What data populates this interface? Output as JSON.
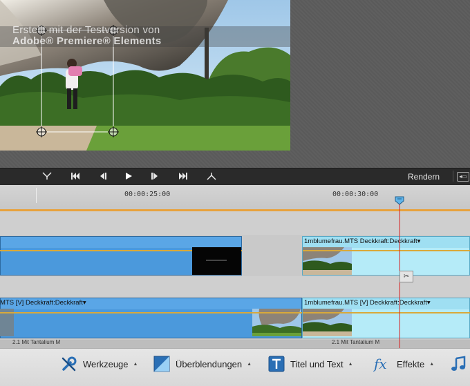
{
  "monitor": {
    "watermark_line1": "Erstellt mit der Testversion von",
    "watermark_line2": "Adobe® Premiere® Elements"
  },
  "transport": {
    "buttons": [
      {
        "name": "goto-in-button",
        "glyph": "⊻"
      },
      {
        "name": "goto-start-button",
        "glyph": "⏮"
      },
      {
        "name": "step-back-button",
        "glyph": "◀❙"
      },
      {
        "name": "play-button",
        "glyph": "▶"
      },
      {
        "name": "step-forward-button",
        "glyph": "❙▶"
      },
      {
        "name": "goto-end-button",
        "glyph": "⏭"
      },
      {
        "name": "goto-out-button",
        "glyph": "⊻"
      }
    ],
    "render_label": "Rendern",
    "render_menu_glyph": "◂▭"
  },
  "ruler": {
    "timecode_1": "00:00:25:00",
    "timecode_2": "00:00:30:00"
  },
  "tracks": {
    "upper_clip_right_label": "1mblumefrau.MTS",
    "upper_clip_right_opacity": "Deckkraft:Deckkraft",
    "lower_clip_left_label": "MTS [V]",
    "lower_clip_left_opacity": "Deckkraft:Deckkraft",
    "lower_clip_right_label": "1mblumefrau.MTS [V]",
    "lower_clip_right_opacity": "Deckkraft:Deckkraft",
    "lower_clip_left_bottom_text": "2.1 Mit Tantalium M",
    "lower_clip_right_bottom_text": "2.1 Mit Tantalium M",
    "dropdown_glyph": "▾",
    "scissors_glyph": "✂"
  },
  "toolbar": {
    "tools_label": "Werkzeuge",
    "transitions_label": "Überblendungen",
    "titles_label": "Titel und Text",
    "effects_label": "Effekte",
    "caret": "▲"
  },
  "colors": {
    "accent_orange": "#e8a23c",
    "playhead_red": "#d62020",
    "clip_blue": "#4b99dc",
    "clip_light_blue": "#b5ebf8"
  }
}
